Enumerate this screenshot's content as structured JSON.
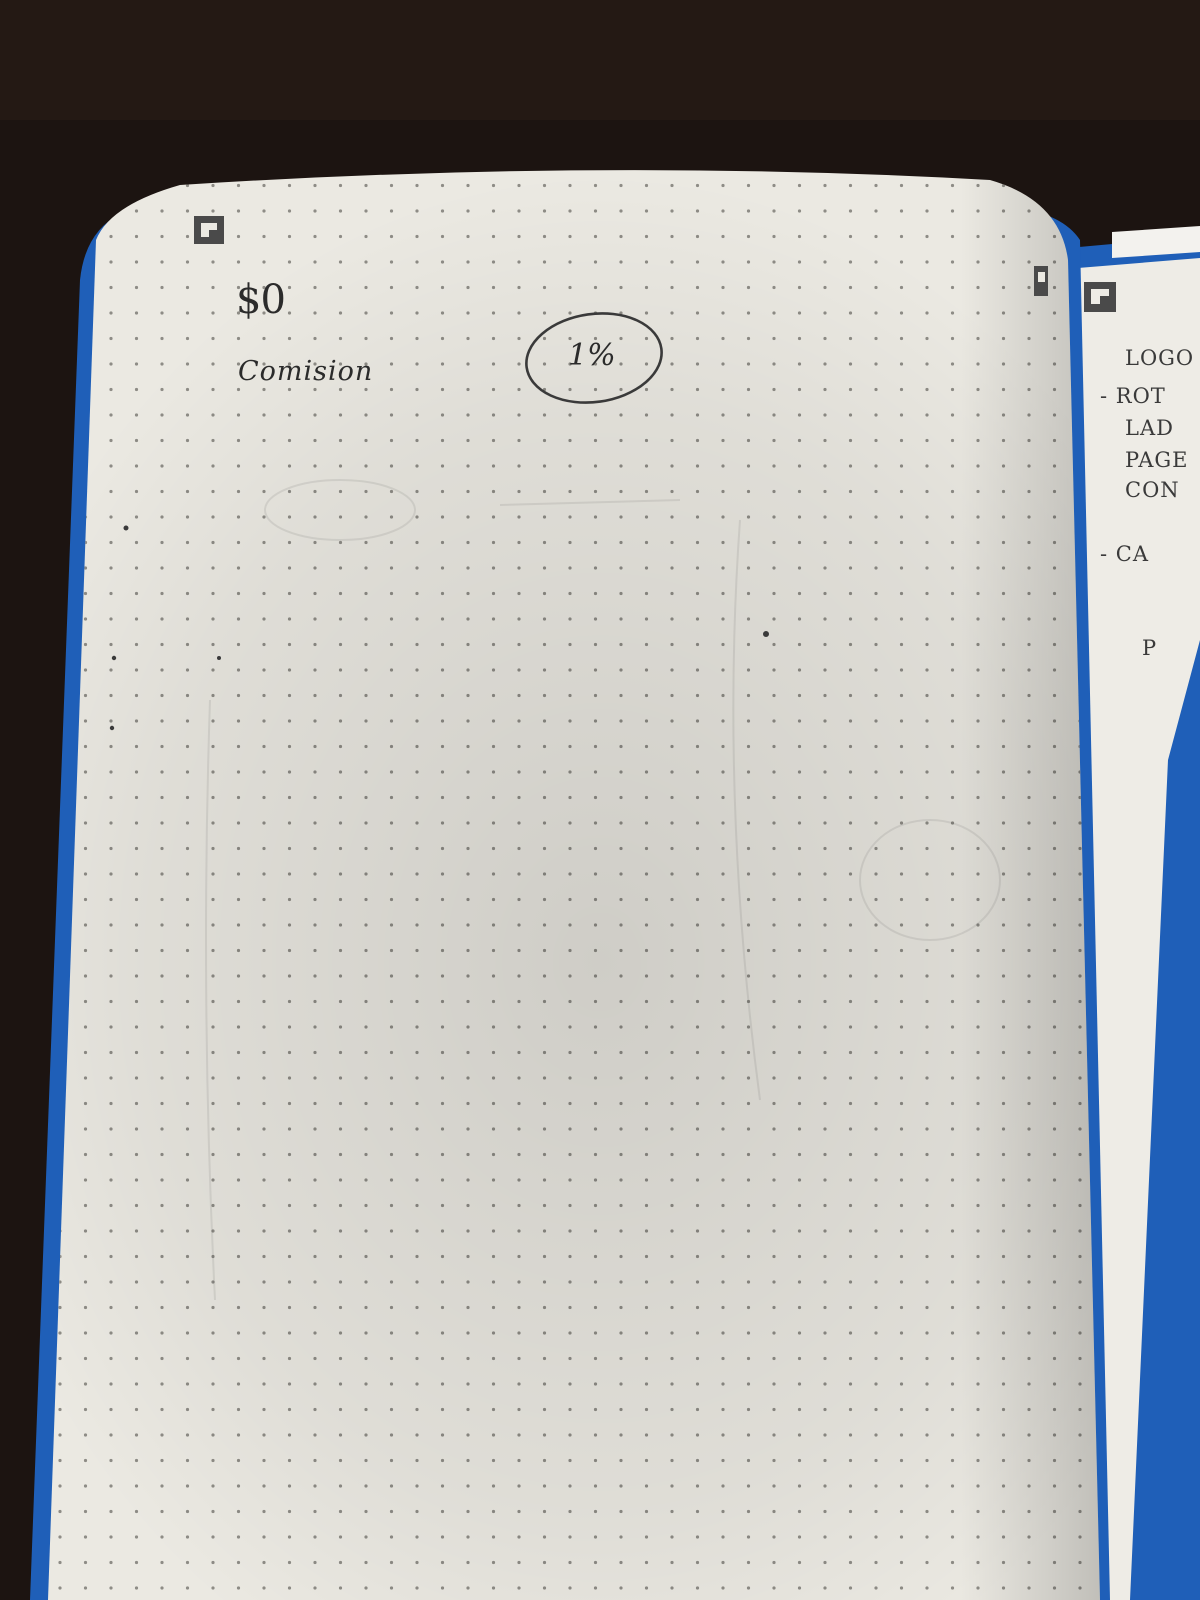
{
  "photo": {
    "background_color": "#1c1411",
    "cover_color": "#1f5fb8",
    "page_color": "#ebe9e2",
    "dot_color": "#8e8c86"
  },
  "left_page": {
    "corner_icon": "notebook-corner-logo-icon",
    "amount": "$0",
    "label": "Comision",
    "circled_value": "1%"
  },
  "right_page": {
    "corner_icon": "notebook-corner-logo-icon",
    "lines": [
      "LOGO",
      "- ROT",
      "LAD",
      "PAGE",
      "CON",
      "- CA",
      "P"
    ]
  }
}
